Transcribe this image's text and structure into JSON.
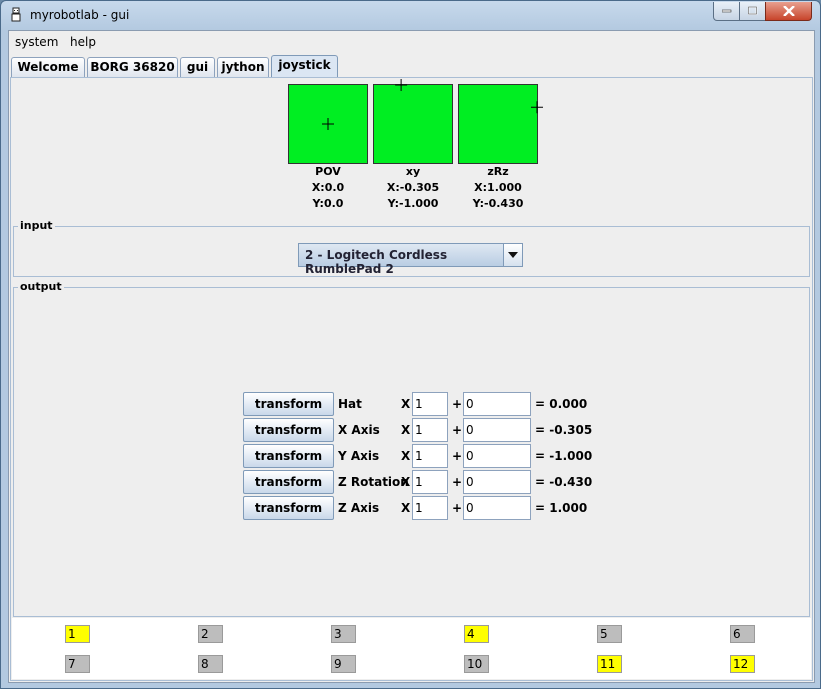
{
  "window": {
    "title": "myrobotlab - gui",
    "icon": "robot-app-icon",
    "controls": [
      "minimize-icon",
      "maximize-icon",
      "close-icon"
    ]
  },
  "menu": {
    "items": [
      "system",
      "help"
    ]
  },
  "tabs": [
    {
      "label": "Welcome",
      "active": false
    },
    {
      "label": "BORG 36820",
      "active": false
    },
    {
      "label": "gui",
      "active": false
    },
    {
      "label": "jython",
      "active": false
    },
    {
      "label": "joystick",
      "active": true
    }
  ],
  "pads": [
    {
      "label": "POV",
      "x_text": "X:0.0",
      "y_text": "Y:0.0",
      "x": 0.0,
      "y": 0.0
    },
    {
      "label": "xy",
      "x_text": "X:-0.305",
      "y_text": "Y:-1.000",
      "x": -0.305,
      "y": -1.0
    },
    {
      "label": "zRz",
      "x_text": "X:1.000",
      "y_text": "Y:-0.430",
      "x": 1.0,
      "y": -0.43
    }
  ],
  "colors": {
    "pad": "#00ee22",
    "button_on": "#ffff00",
    "button_off": "#bdbdbd"
  },
  "input": {
    "title": "input",
    "selected_controller": "2 - Logitech Cordless RumblePad 2"
  },
  "output": {
    "title": "output",
    "rows": [
      {
        "button": "transform",
        "label": "Hat",
        "x_label": "X",
        "multiplier": "1",
        "plus": "+",
        "offset": "0",
        "result": "= 0.000"
      },
      {
        "button": "transform",
        "label": "X Axis",
        "x_label": "X",
        "multiplier": "1",
        "plus": "+",
        "offset": "0",
        "result": "= -0.305"
      },
      {
        "button": "transform",
        "label": "Y Axis",
        "x_label": "X",
        "multiplier": "1",
        "plus": "+",
        "offset": "0",
        "result": "= -1.000"
      },
      {
        "button": "transform",
        "label": "Z Rotation",
        "x_label": "X",
        "multiplier": "1",
        "plus": "+",
        "offset": "0",
        "result": "= -0.430"
      },
      {
        "button": "transform",
        "label": "Z Axis",
        "x_label": "X",
        "multiplier": "1",
        "plus": "+",
        "offset": "0",
        "result": "= 1.000"
      }
    ]
  },
  "buttons": [
    {
      "label": "1",
      "pressed": true
    },
    {
      "label": "2",
      "pressed": false
    },
    {
      "label": "3",
      "pressed": false
    },
    {
      "label": "4",
      "pressed": true
    },
    {
      "label": "5",
      "pressed": false
    },
    {
      "label": "6",
      "pressed": false
    },
    {
      "label": "7",
      "pressed": false
    },
    {
      "label": "8",
      "pressed": false
    },
    {
      "label": "9",
      "pressed": false
    },
    {
      "label": "10",
      "pressed": false
    },
    {
      "label": "11",
      "pressed": true
    },
    {
      "label": "12",
      "pressed": true
    }
  ]
}
